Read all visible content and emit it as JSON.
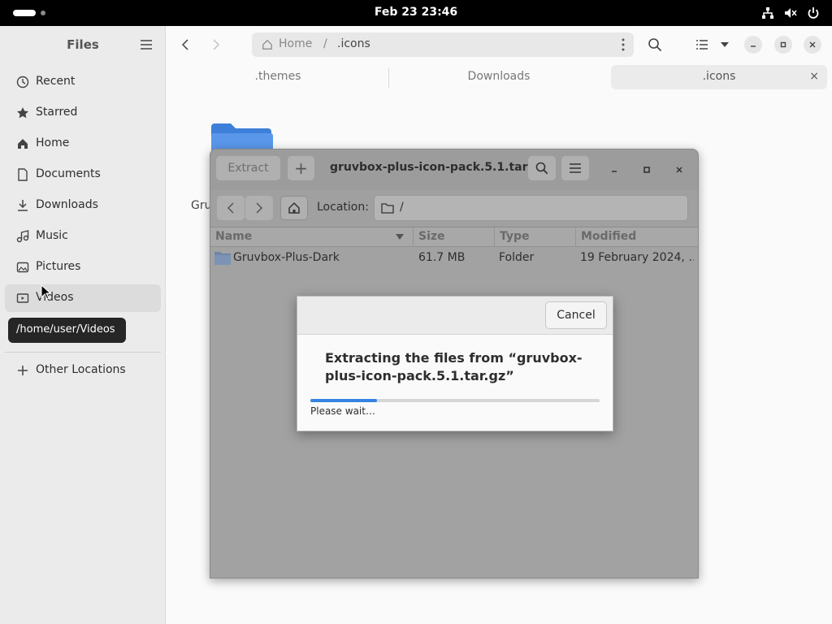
{
  "topbar": {
    "clock": "Feb 23  23:46"
  },
  "sidebar": {
    "title": "Files",
    "items": [
      {
        "label": "Recent",
        "icon": "clock-icon"
      },
      {
        "label": "Starred",
        "icon": "star-icon"
      },
      {
        "label": "Home",
        "icon": "home-icon"
      },
      {
        "label": "Documents",
        "icon": "document-icon"
      },
      {
        "label": "Downloads",
        "icon": "download-icon"
      },
      {
        "label": "Music",
        "icon": "music-icon"
      },
      {
        "label": "Pictures",
        "icon": "picture-icon"
      },
      {
        "label": "Videos",
        "icon": "video-icon"
      }
    ],
    "other_locations": "Other Locations",
    "tooltip": "/home/user/Videos"
  },
  "files": {
    "path_home": "Home",
    "path_sep": "/",
    "path_current": ".icons",
    "tabs": [
      {
        "label": ".themes"
      },
      {
        "label": "Downloads"
      },
      {
        "label": ".icons"
      }
    ],
    "tab_close": "×",
    "partial_label": "Gru"
  },
  "archive": {
    "extract_label": "Extract",
    "add_label": "+",
    "title": "gruvbox-plus-icon-pack.5.1.tar…",
    "location_label": "Location:",
    "location_value": "/",
    "columns": [
      "Name",
      "Size",
      "Type",
      "Modified"
    ],
    "rows": [
      {
        "name": "Gruvbox-Plus-Dark",
        "size": "61.7 MB",
        "type": "Folder",
        "modified": "19 February 2024, …"
      }
    ]
  },
  "dialog": {
    "cancel_label": "Cancel",
    "message": "Extracting the files from “gruvbox-plus-icon-pack.5.1.tar.gz”",
    "progress": 0.23,
    "status": "Please wait…"
  },
  "colors": {
    "accent": "#3584e4",
    "folder": "#3d7fd9"
  }
}
